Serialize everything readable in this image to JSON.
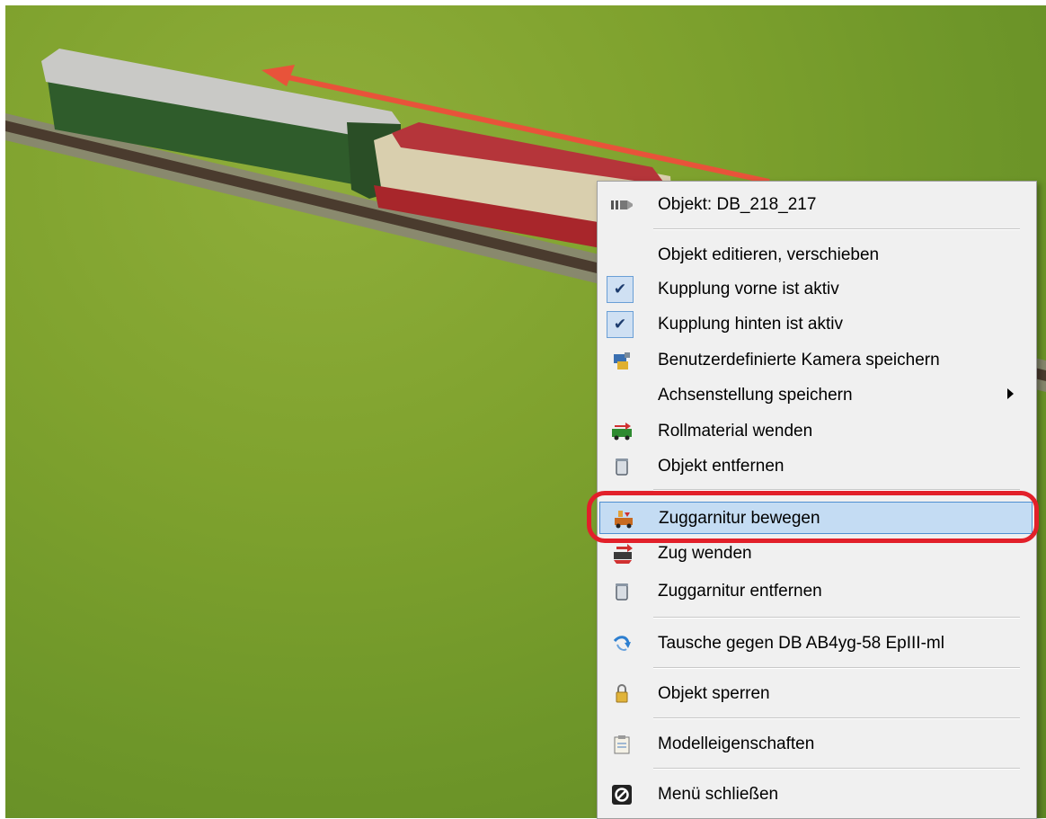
{
  "context_menu": {
    "header": {
      "label": "Objekt: DB_218_217",
      "icon": "object-info-icon"
    },
    "items": [
      {
        "label": "Objekt editieren, verschieben",
        "icon": ""
      },
      {
        "label": "Kupplung vorne ist aktiv",
        "checked": true
      },
      {
        "label": "Kupplung hinten ist aktiv",
        "checked": true
      },
      {
        "label": "Benutzerdefinierte Kamera speichern",
        "icon": "camera-save-icon"
      },
      {
        "label": "Achsenstellung speichern",
        "icon": "",
        "submenu": true
      },
      {
        "label": "Rollmaterial wenden",
        "icon": "rolling-stock-turn-icon"
      },
      {
        "label": "Objekt entfernen",
        "icon": "trash-can-icon"
      },
      {
        "label": "Zuggarnitur bewegen",
        "icon": "move-train-icon",
        "highlighted": true
      },
      {
        "label": "Zug wenden",
        "icon": "turn-train-icon"
      },
      {
        "label": "Zuggarnitur entfernen",
        "icon": "trash-can-icon"
      },
      {
        "label": "Tausche gegen DB AB4yg-58 EpIII-ml",
        "icon": "swap-icon"
      },
      {
        "label": "Objekt sperren",
        "icon": "lock-icon"
      },
      {
        "label": "Modelleigenschaften",
        "icon": "clipboard-icon"
      },
      {
        "label": "Menü schließen",
        "icon": "close-menu-icon"
      }
    ]
  },
  "colors": {
    "highlight": "#c4dcf3",
    "highlight_border": "#4f90d1",
    "annotation_red": "#e2202a"
  }
}
